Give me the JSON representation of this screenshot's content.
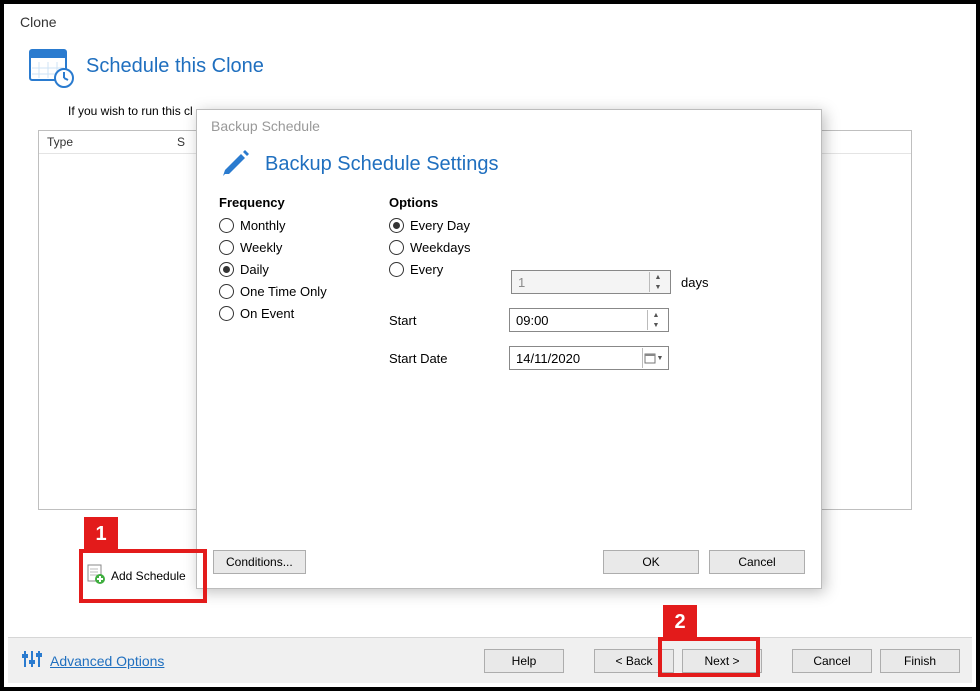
{
  "window_title": "Clone",
  "page_title": "Schedule this Clone",
  "intro_text": "If you wish to run this cl",
  "table": {
    "columns": {
      "type": "Type",
      "second": "S"
    }
  },
  "add_schedule_label": "Add Schedule",
  "advanced_options_label": "Advanced Options",
  "buttons": {
    "help": "Help",
    "back": "<  Back",
    "next": "Next  >",
    "cancel": "Cancel",
    "finish": "Finish"
  },
  "modal": {
    "title": "Backup Schedule",
    "heading": "Backup Schedule Settings",
    "frequency_label": "Frequency",
    "options_label": "Options",
    "frequency": {
      "monthly": "Monthly",
      "weekly": "Weekly",
      "daily": "Daily",
      "one_time": "One Time Only",
      "on_event": "On Event"
    },
    "options": {
      "every_day": "Every Day",
      "weekdays": "Weekdays",
      "every": "Every",
      "every_value": "1",
      "every_unit": "days",
      "start_label": "Start",
      "start_value": "09:00",
      "start_date_label": "Start Date",
      "start_date_value": "14/11/2020"
    },
    "conditions": "Conditions...",
    "ok": "OK",
    "cancel": "Cancel"
  },
  "callouts": {
    "one": "1",
    "two": "2"
  }
}
